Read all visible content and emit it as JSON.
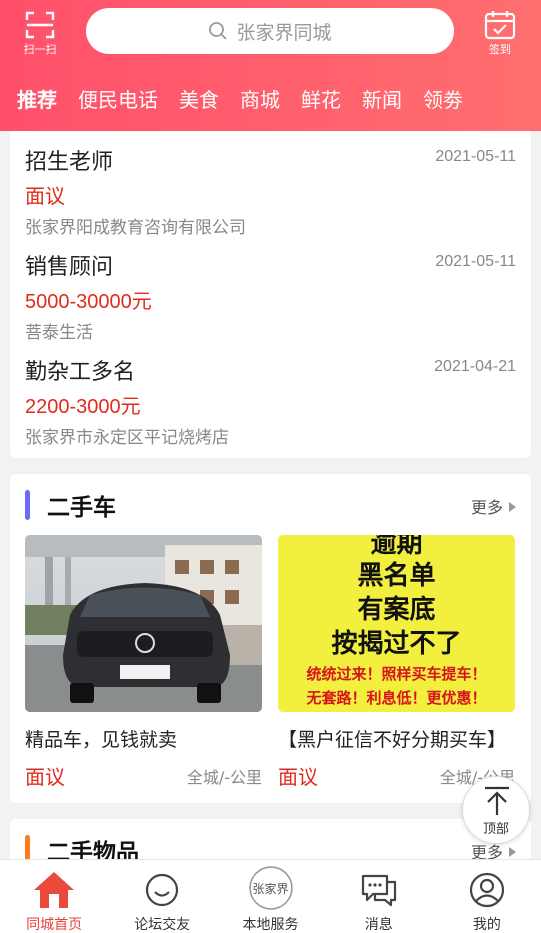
{
  "header": {
    "scan_label": "扫一扫",
    "search_placeholder": "张家界同城",
    "sign_label": "签到",
    "tabs": [
      "推荐",
      "便民电话",
      "美食",
      "商城",
      "鲜花",
      "新闻",
      "领劵"
    ]
  },
  "jobs": [
    {
      "title": "招生老师",
      "date": "2021-05-11",
      "salary": "面议",
      "company": "张家界阳成教育咨询有限公司"
    },
    {
      "title": "销售顾问",
      "date": "2021-05-11",
      "salary": "5000-30000元",
      "company": "菩泰生活"
    },
    {
      "title": "勤杂工多名",
      "date": "2021-04-21",
      "salary": "2200-3000元",
      "company": "张家界市永定区平记烧烤店"
    }
  ],
  "used_cars": {
    "title": "二手车",
    "more": "更多",
    "items": [
      {
        "name": "精品车，见钱就卖",
        "price": "面议",
        "location": "全城/-公里"
      },
      {
        "name": "【黑户征信不好分期买车】",
        "price": "面议",
        "location": "全城/-公里",
        "poster_lines": [
          "逾期",
          "黑名单",
          "有案底",
          "按揭过不了",
          "统统过来！照样买车提车！",
          "无套路！利息低！更优惠！"
        ]
      }
    ]
  },
  "used_goods": {
    "title": "二手物品",
    "more": "更多"
  },
  "to_top_label": "顶部",
  "tabbar": [
    {
      "label": "同城首页",
      "active": true
    },
    {
      "label": "论坛交友",
      "active": false
    },
    {
      "label": "本地服务",
      "active": false,
      "badge": "张家界"
    },
    {
      "label": "消息",
      "active": false
    },
    {
      "label": "我的",
      "active": false
    }
  ],
  "colors": {
    "header": "#ff5a6c",
    "accent_red": "#e12b1f",
    "cars_bar": "#6a6af5",
    "goods_bar": "#ff7a1a"
  }
}
